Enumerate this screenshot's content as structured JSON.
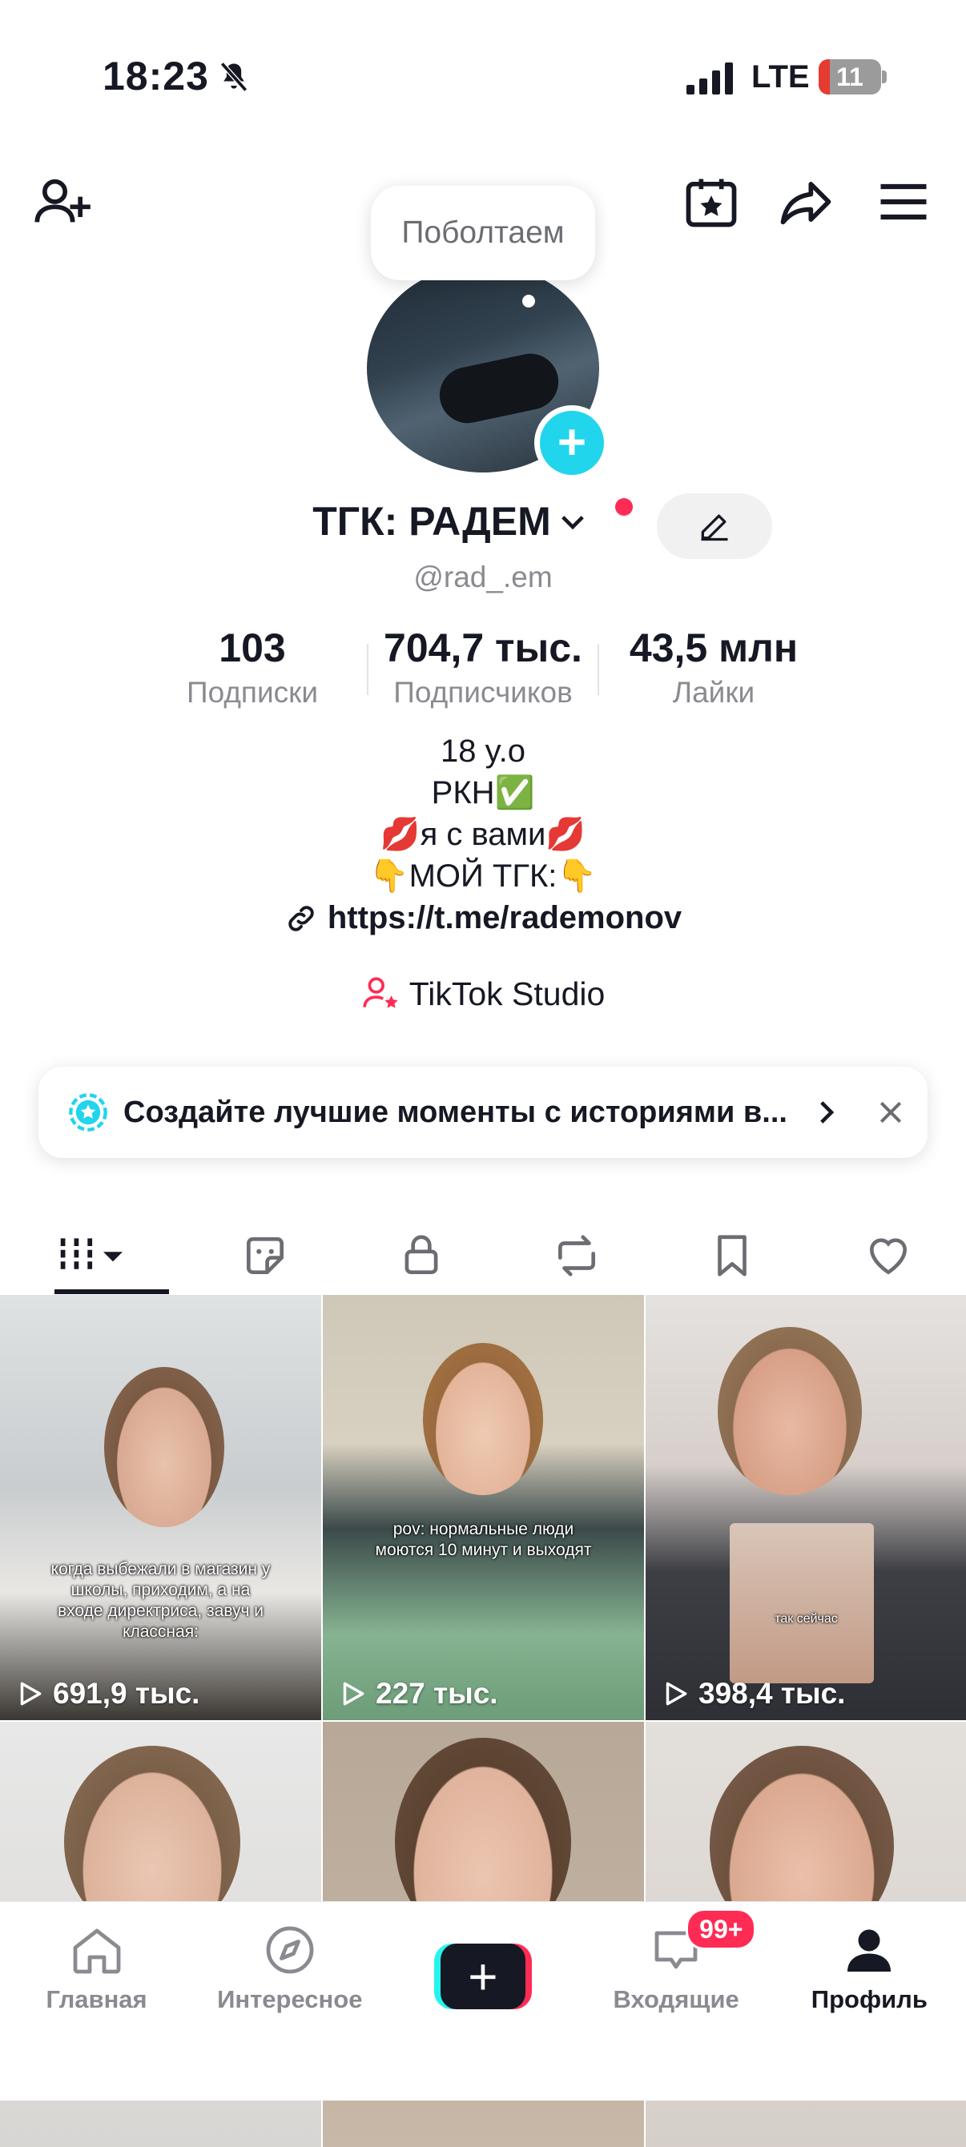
{
  "status_bar": {
    "time": "18:23",
    "network": "LTE",
    "battery": "11"
  },
  "top_bar": {
    "bubble_text": "Поболтаем"
  },
  "profile": {
    "nickname": "ТГК: РАДЕМ",
    "username": "@rad_.em"
  },
  "stats": [
    {
      "value": "103",
      "label": "Подписки"
    },
    {
      "value": "704,7 тыс.",
      "label": "Подписчиков"
    },
    {
      "value": "43,5 млн",
      "label": "Лайки"
    }
  ],
  "bio": {
    "line1": "18 y.o",
    "line2": "РКН✅",
    "line3": "💋я с вами💋",
    "line4": "👇МОЙ ТГК:👇",
    "link": "https://t.me/rademonov"
  },
  "studio": {
    "label": "TikTok Studio"
  },
  "banner": {
    "text": "Создайте лучшие моменты с историями в..."
  },
  "videos": [
    {
      "views": "691,9 тыс.",
      "caption": "когда выбежали в магазин у школы, приходим, а на входе директриса, завуч и классная:"
    },
    {
      "views": "227 тыс.",
      "caption": "pov: нормальные люди моются 10 минут и выходят"
    },
    {
      "views": "398,4 тыс.",
      "caption": "так сейчас"
    },
    {
      "views": "",
      "caption": ""
    },
    {
      "views": "",
      "caption": ""
    },
    {
      "views": "",
      "caption": ""
    }
  ],
  "nav": {
    "home": "Главная",
    "discover": "Интересное",
    "inbox": "Входящие",
    "inbox_badge": "99+",
    "profile": "Профиль"
  },
  "colors": {
    "accent": "#fe2c55",
    "cyan": "#20d5ec",
    "text": "#161823",
    "muted": "#8a8b91"
  }
}
